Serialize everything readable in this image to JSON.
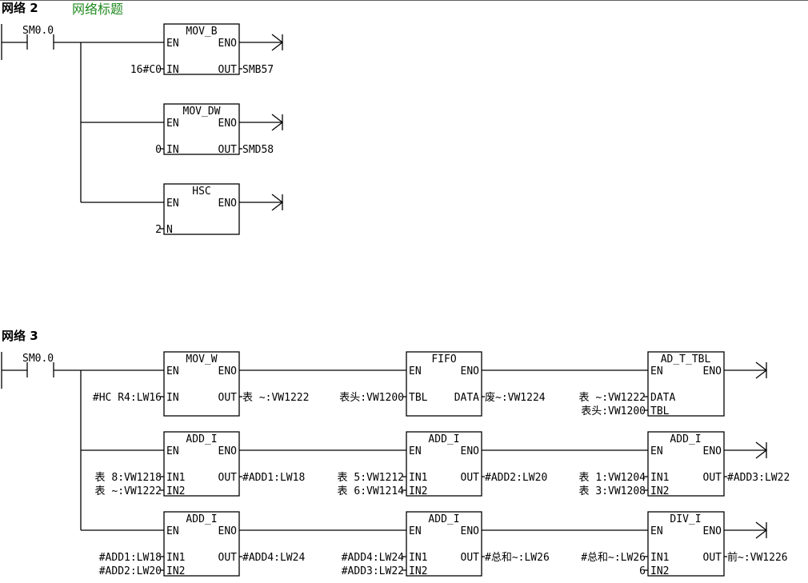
{
  "networks": [
    {
      "header": "网络 2",
      "comment": "网络标题",
      "contact": "SM0.0",
      "blocks": [
        {
          "name": "MOV_B",
          "en": "EN",
          "eno": "ENO",
          "in": [
            {
              "pin": "IN",
              "value": "16#C0"
            }
          ],
          "out": [
            {
              "pin": "OUT",
              "value": "SMB57"
            }
          ]
        },
        {
          "name": "MOV_DW",
          "en": "EN",
          "eno": "ENO",
          "in": [
            {
              "pin": "IN",
              "value": "0"
            }
          ],
          "out": [
            {
              "pin": "OUT",
              "value": "SMD58"
            }
          ]
        },
        {
          "name": "HSC",
          "en": "EN",
          "eno": "ENO",
          "in": [
            {
              "pin": "N",
              "value": "2"
            }
          ],
          "out": []
        }
      ]
    },
    {
      "header": "网络 3",
      "comment": "",
      "contact": "SM0.0",
      "rows": [
        [
          {
            "name": "MOV_W",
            "en": "EN",
            "eno": "ENO",
            "in": [
              {
                "pin": "IN",
                "value": "#HC R4:LW16"
              }
            ],
            "out": [
              {
                "pin": "OUT",
                "value": "表 ~:VW1222"
              }
            ]
          },
          {
            "name": "FIFO",
            "en": "EN",
            "eno": "ENO",
            "in": [
              {
                "pin": "TBL",
                "value": "表头:VW1200"
              }
            ],
            "out": [
              {
                "pin": "DATA",
                "value": "废~:VW1224"
              }
            ]
          },
          {
            "name": "AD_T_TBL",
            "en": "EN",
            "eno": "ENO",
            "in": [
              {
                "pin": "DATA",
                "value": "表 ~:VW1222"
              },
              {
                "pin": "TBL",
                "value": "表头:VW1200"
              }
            ],
            "out": []
          }
        ],
        [
          {
            "name": "ADD_I",
            "en": "EN",
            "eno": "ENO",
            "in": [
              {
                "pin": "IN1",
                "value": "表 8:VW1218"
              },
              {
                "pin": "IN2",
                "value": "表 ~:VW1222"
              }
            ],
            "out": [
              {
                "pin": "OUT",
                "value": "#ADD1:LW18"
              }
            ]
          },
          {
            "name": "ADD_I",
            "en": "EN",
            "eno": "ENO",
            "in": [
              {
                "pin": "IN1",
                "value": "表 5:VW1212"
              },
              {
                "pin": "IN2",
                "value": "表 6:VW1214"
              }
            ],
            "out": [
              {
                "pin": "OUT",
                "value": "#ADD2:LW20"
              }
            ]
          },
          {
            "name": "ADD_I",
            "en": "EN",
            "eno": "ENO",
            "in": [
              {
                "pin": "IN1",
                "value": "表 1:VW1204"
              },
              {
                "pin": "IN2",
                "value": "表 3:VW1208"
              }
            ],
            "out": [
              {
                "pin": "OUT",
                "value": "#ADD3:LW22"
              }
            ]
          }
        ],
        [
          {
            "name": "ADD_I",
            "en": "EN",
            "eno": "ENO",
            "in": [
              {
                "pin": "IN1",
                "value": "#ADD1:LW18"
              },
              {
                "pin": "IN2",
                "value": "#ADD2:LW20"
              }
            ],
            "out": [
              {
                "pin": "OUT",
                "value": "#ADD4:LW24"
              }
            ]
          },
          {
            "name": "ADD_I",
            "en": "EN",
            "eno": "ENO",
            "in": [
              {
                "pin": "IN1",
                "value": "#ADD4:LW24"
              },
              {
                "pin": "IN2",
                "value": "#ADD3:LW22"
              }
            ],
            "out": [
              {
                "pin": "OUT",
                "value": "#总和~:LW26"
              }
            ]
          },
          {
            "name": "DIV_I",
            "en": "EN",
            "eno": "ENO",
            "in": [
              {
                "pin": "IN1",
                "value": "#总和~:LW26"
              },
              {
                "pin": "IN2",
                "value": "6"
              }
            ],
            "out": [
              {
                "pin": "OUT",
                "value": "前~:VW1226"
              }
            ]
          }
        ]
      ]
    }
  ]
}
